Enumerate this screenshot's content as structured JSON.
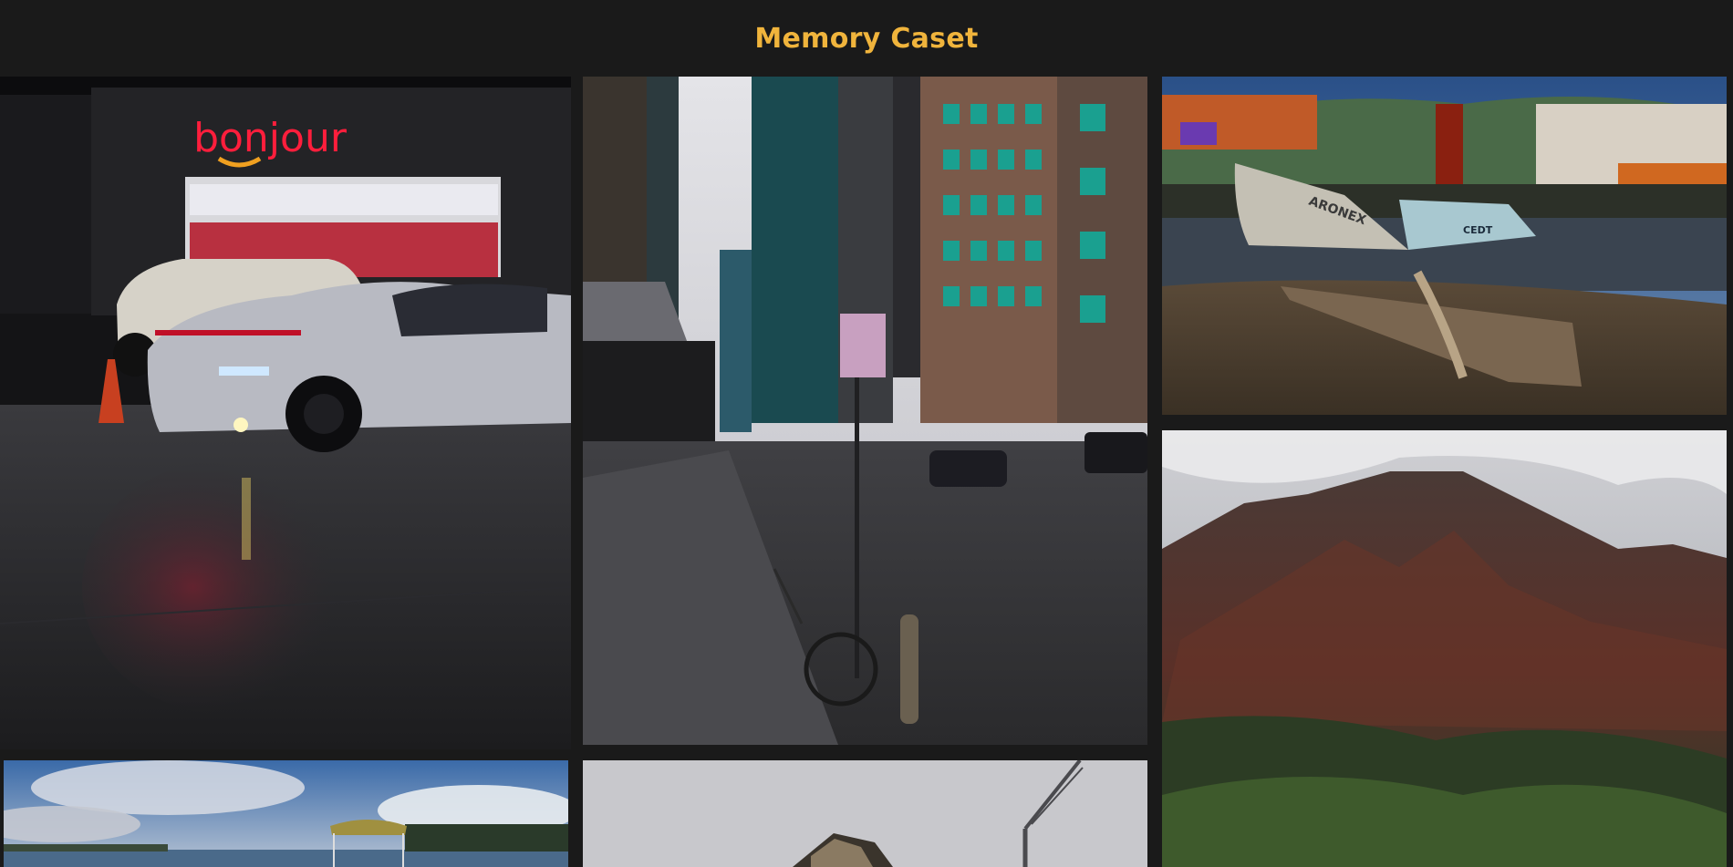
{
  "header": {
    "title": "Memory Caset"
  },
  "gallery": {
    "photos": [
      {
        "signage": "bonjour"
      },
      {
        "signage": ""
      },
      {
        "hull_text": "ARONEX",
        "boat_label": "CEDT"
      },
      {
        "signage": ""
      },
      {
        "signage": ""
      },
      {
        "signage": ""
      }
    ]
  },
  "colors": {
    "background": "#1a1a1a",
    "title": "#f0b43c"
  }
}
